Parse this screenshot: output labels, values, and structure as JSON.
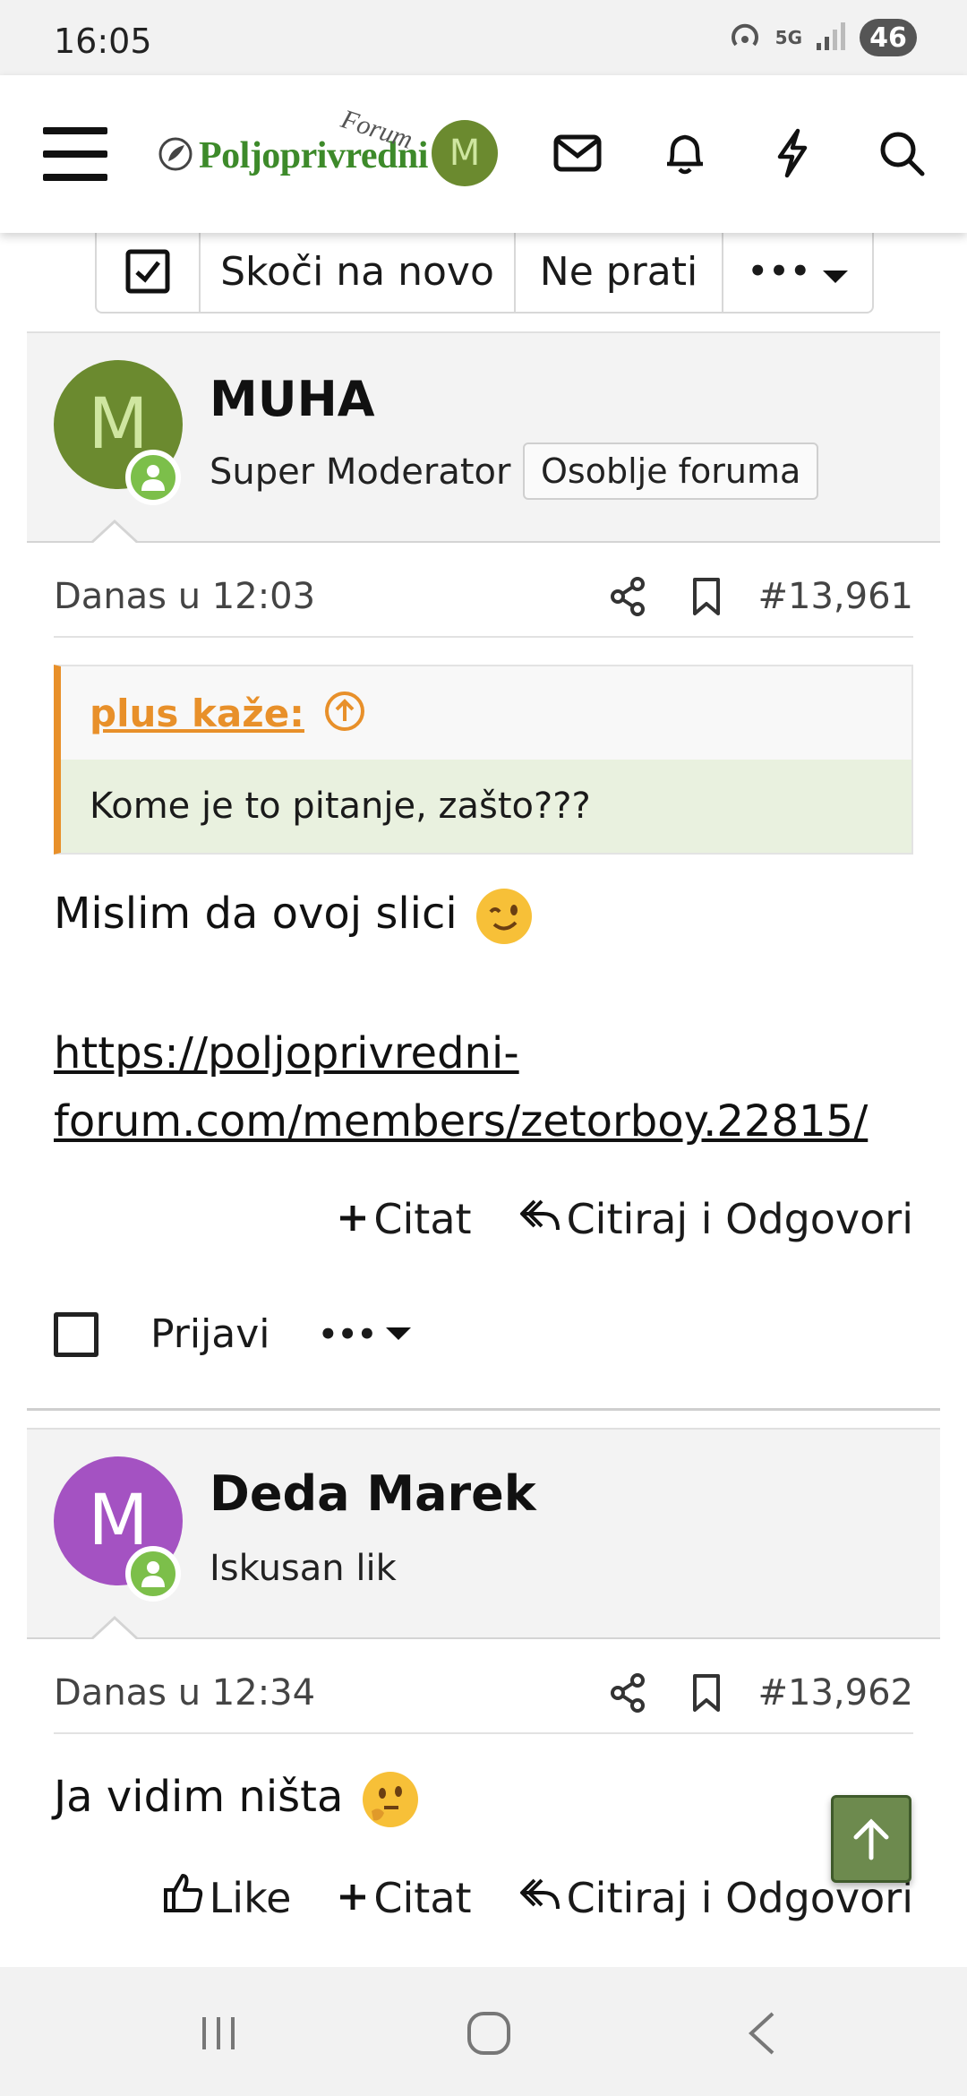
{
  "status_bar": {
    "time": "16:05",
    "network": "5G",
    "battery": "46"
  },
  "header": {
    "logo_text": "Poljoprivredni",
    "logo_suffix": "Forum",
    "avatar_letter": "M"
  },
  "toolbar": {
    "jump_label": "Skoči na novo",
    "unwatch_label": "Ne prati",
    "more_label": "•••"
  },
  "posts": [
    {
      "avatar_letter": "M",
      "avatar_color": "#6b8a2f",
      "avatar_text_color": "#cfe6a0",
      "username": "MUHA",
      "user_title": "Super Moderator",
      "user_banner": "Osoblje foruma",
      "date": "Danas u 12:03",
      "post_number": "#13,961",
      "quote": {
        "author": "plus kaže:",
        "text": "Kome je to pitanje, zašto???"
      },
      "message": "Mislim da ovoj slici",
      "link_line1": "https://poljoprivredni-",
      "link_line2": "forum.com/members/zetorboy.22815/",
      "actions": {
        "quote": "Citat",
        "reply": "Citiraj i Odgovori"
      },
      "report": "Prijavi",
      "more": "•••"
    },
    {
      "avatar_letter": "M",
      "avatar_color": "#a452c2",
      "avatar_text_color": "#ffffff",
      "username": "Deda Marek",
      "user_title": "Iskusan lik",
      "date": "Danas u 12:34",
      "post_number": "#13,962",
      "message": "Ja vidim ništa",
      "actions": {
        "like": "Like",
        "quote": "Citat",
        "reply": "Citiraj i Odgovori"
      }
    }
  ],
  "colors": {
    "brand_green": "#3d8a2a",
    "quote_accent": "#e8902a",
    "online": "#7cbf4a"
  },
  "icons": [
    "menu-icon",
    "envelope-icon",
    "bell-icon",
    "bolt-icon",
    "search-icon",
    "share-icon",
    "bookmark-icon",
    "reply-icon",
    "thumbs-up-icon",
    "arrow-up-icon",
    "circle-arrow-up-icon"
  ]
}
